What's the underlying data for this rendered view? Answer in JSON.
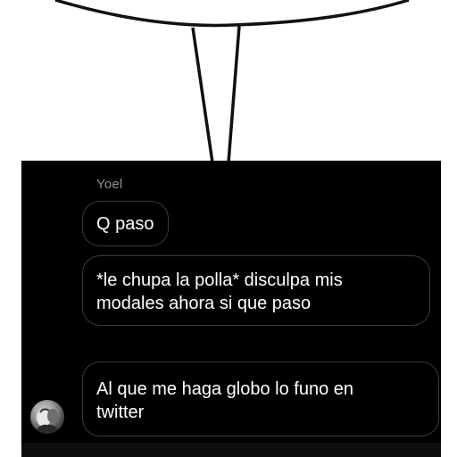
{
  "conversation": {
    "sender": "Yoel",
    "messages": [
      {
        "text": "Q paso"
      },
      {
        "text": "*le chupa la polla* disculpa mis\nmodales ahora si que paso"
      },
      {
        "text": "Al que me haga globo lo funo en\ntwitter"
      }
    ]
  },
  "colors": {
    "chat_background": "#000000",
    "bubble_border": "#3c3c3c",
    "sender_name": "#8f8f8f",
    "message_text": "#ffffff"
  }
}
